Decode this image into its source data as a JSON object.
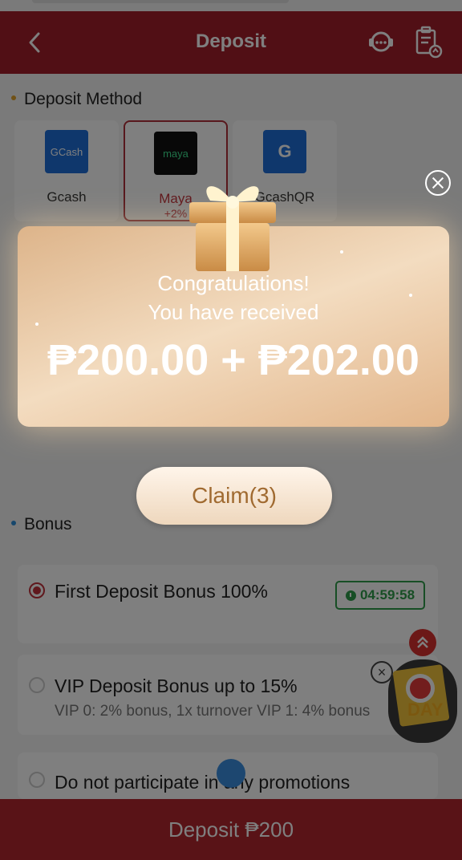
{
  "header": {
    "title": "Deposit"
  },
  "deposit_method": {
    "title": "Deposit Method",
    "methods": [
      {
        "label": "Gcash",
        "logo_text": "GCash",
        "sublabel": ""
      },
      {
        "label": "Maya",
        "logo_text": "maya",
        "sublabel": "+2%"
      },
      {
        "label": "GcashQR",
        "logo_text": "G",
        "sublabel": ""
      }
    ]
  },
  "bonus": {
    "title": "Bonus",
    "options": [
      {
        "title": "First Deposit Bonus 100%",
        "desc": "",
        "timer": "04:59:58",
        "selected": true
      },
      {
        "title": "VIP Deposit Bonus up to 15%",
        "desc": "VIP 0: 2% bonus, 1x turnover VIP 1: 4% bonus",
        "selected": false
      },
      {
        "title": "Do not participate in any promotions",
        "desc": "",
        "selected": false
      }
    ]
  },
  "day_widget": {
    "text": "DAY"
  },
  "footer": {
    "button_label": "Deposit ₱200"
  },
  "popup": {
    "line1": "Congratulations!",
    "line2": "You have received",
    "amount": "₱200.00 + ₱202.00",
    "claim_label": "Claim(3)"
  },
  "colors": {
    "brand": "#a31f2a",
    "accent": "#c0303a",
    "timer": "#2f9d4a",
    "gold": "#e2b58a"
  }
}
